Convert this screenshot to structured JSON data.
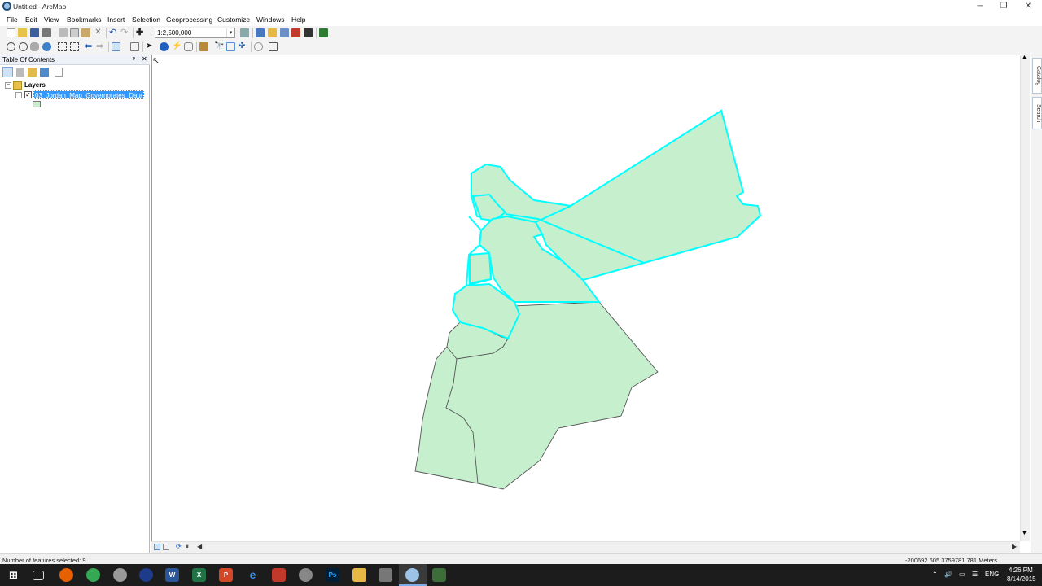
{
  "window": {
    "title": "Untitled - ArcMap",
    "minimize": "─",
    "restore": "❐",
    "close": "✕"
  },
  "menu": [
    "File",
    "Edit",
    "View",
    "Bookmarks",
    "Insert",
    "Selection",
    "Geoprocessing",
    "Customize",
    "Windows",
    "Help"
  ],
  "toolbar": {
    "scale_value": "1:2,500,000"
  },
  "toc": {
    "title": "Table Of Contents",
    "pin": "ᵖ",
    "close": "✕",
    "layers_group": "Layers",
    "layer_name": "03_Jordan_Map_Governorates_Data",
    "layer_checked": true,
    "expand_minus": "−"
  },
  "dock": {
    "catalog": "Catalog",
    "search": "Search"
  },
  "status": {
    "features": "Number of features selected: 9",
    "coordinates": "-200692.605  3759781.781 Meters"
  },
  "tray": {
    "time": "4:26 PM",
    "date": "8/14/2015",
    "lang": "ENG"
  },
  "colors": {
    "fill": "#c6efce",
    "selection": "#00ffff",
    "outline": "#555555",
    "highlight": "#3399ff"
  }
}
